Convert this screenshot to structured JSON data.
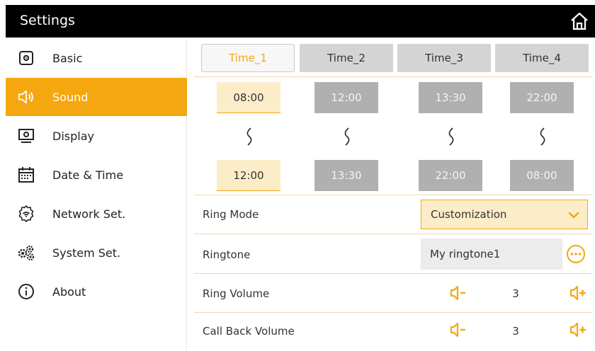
{
  "header": {
    "title": "Settings",
    "home_icon": "home-icon"
  },
  "sidebar": {
    "items": [
      {
        "label": "Basic",
        "icon": "basic-settings-icon"
      },
      {
        "label": "Sound",
        "icon": "speaker-icon",
        "active": true
      },
      {
        "label": "Display",
        "icon": "display-icon"
      },
      {
        "label": "Date & Time",
        "icon": "calendar-icon"
      },
      {
        "label": "Network Set.",
        "icon": "network-gear-icon"
      },
      {
        "label": "System Set.",
        "icon": "gears-icon"
      },
      {
        "label": "About",
        "icon": "info-icon"
      }
    ]
  },
  "tabs": [
    "Time_1",
    "Time_2",
    "Time_3",
    "Time_4"
  ],
  "active_tab": "Time_1",
  "time_ranges": [
    {
      "start": "08:00",
      "end": "12:00"
    },
    {
      "start": "12:00",
      "end": "13:30"
    },
    {
      "start": "13:30",
      "end": "22:00"
    },
    {
      "start": "22:00",
      "end": "08:00"
    }
  ],
  "ring_mode": {
    "label": "Ring Mode",
    "value": "Customization"
  },
  "ringtone": {
    "label": "Ringtone",
    "value": "My ringtone1"
  },
  "ring_volume": {
    "label": "Ring Volume",
    "value": "3"
  },
  "call_back_volume": {
    "label": "Call Back Volume",
    "value": "3"
  },
  "colors": {
    "accent": "#f5a70f",
    "selected_bg": "#fdecc8",
    "disabled": "#b0b0b0"
  }
}
